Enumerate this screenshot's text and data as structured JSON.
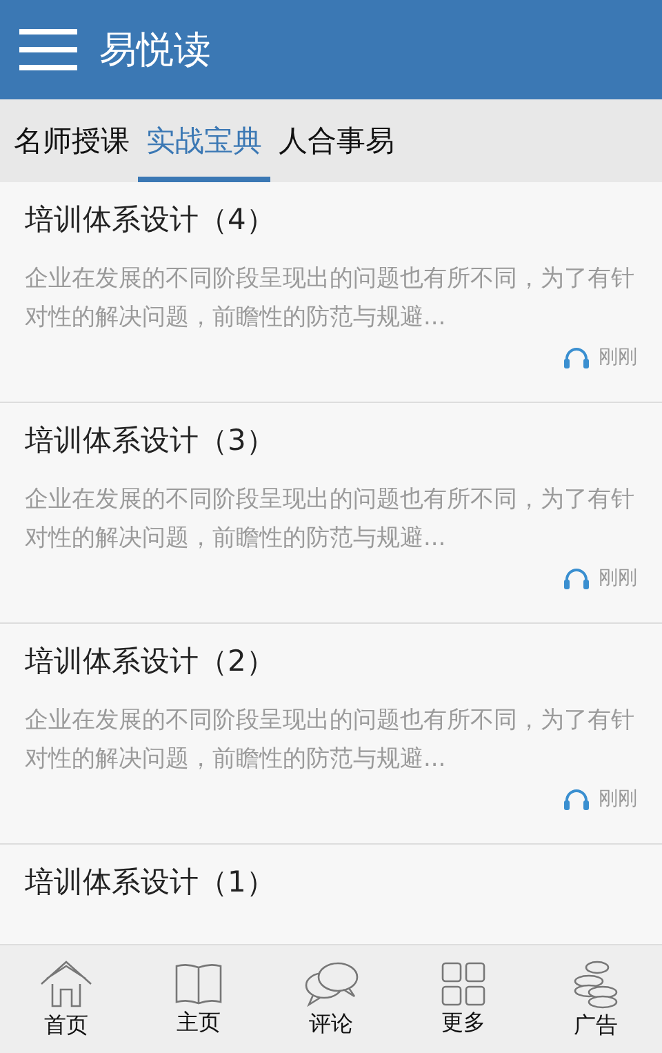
{
  "header": {
    "title": "易悦读"
  },
  "tabs": [
    {
      "label": "名师授课",
      "selected": false
    },
    {
      "label": "实战宝典",
      "selected": true
    },
    {
      "label": "人合事易",
      "selected": false
    }
  ],
  "articles": [
    {
      "title": "培训体系设计（4）",
      "summary": "企业在发展的不同阶段呈现出的问题也有所不同，为了有针对性的解决问题，前瞻性的防范与规避...",
      "time": "刚刚"
    },
    {
      "title": "培训体系设计（3）",
      "summary": "企业在发展的不同阶段呈现出的问题也有所不同，为了有针对性的解决问题，前瞻性的防范与规避...",
      "time": "刚刚"
    },
    {
      "title": "培训体系设计（2）",
      "summary": "企业在发展的不同阶段呈现出的问题也有所不同，为了有针对性的解决问题，前瞻性的防范与规避...",
      "time": "刚刚"
    },
    {
      "title": "培训体系设计（1）"
    }
  ],
  "bottom_nav": [
    {
      "kind": "home",
      "label": "首页"
    },
    {
      "kind": "book",
      "label": "主页"
    },
    {
      "kind": "comment",
      "label": "评论"
    },
    {
      "kind": "grid",
      "label": "更多"
    },
    {
      "kind": "coins",
      "label": "广告"
    }
  ]
}
